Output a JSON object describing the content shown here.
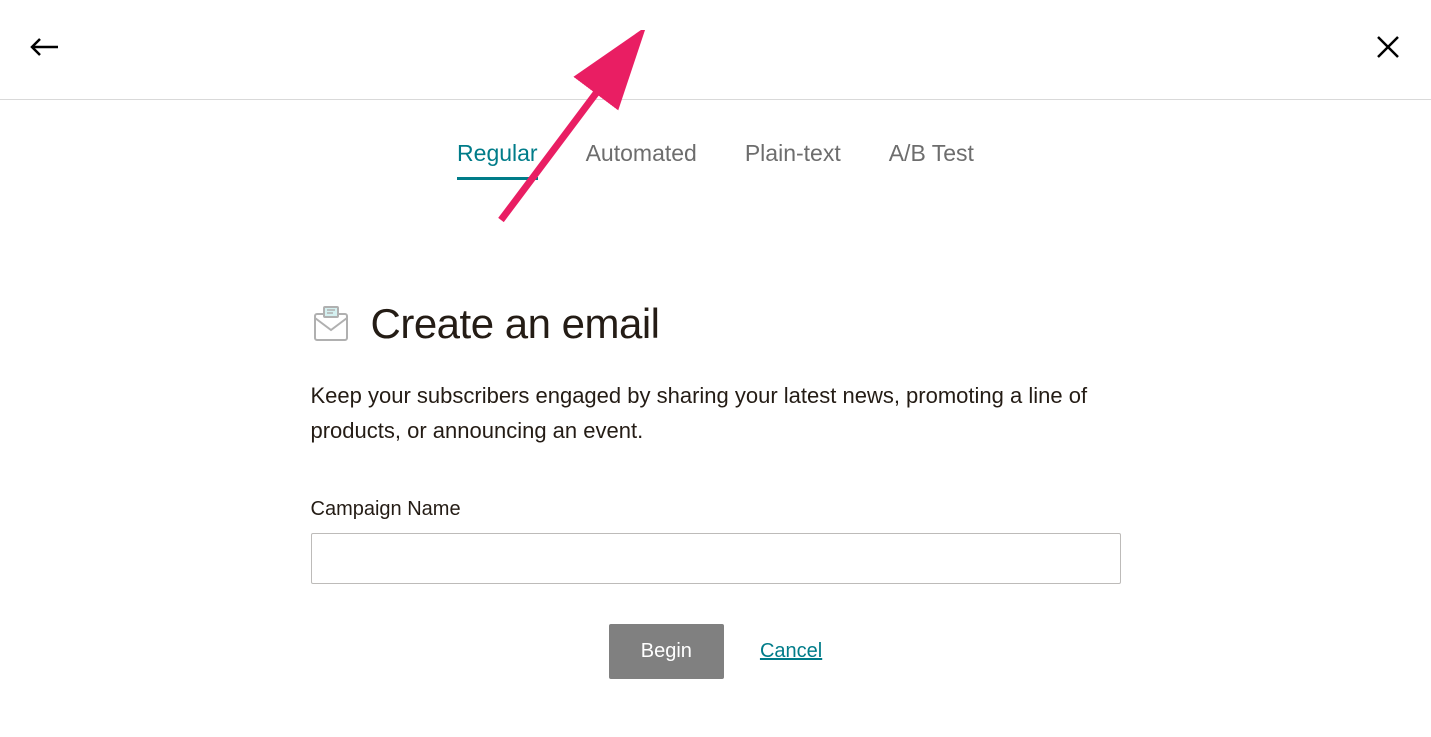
{
  "header": {
    "back_icon": "arrow-left",
    "close_icon": "close"
  },
  "tabs": [
    {
      "label": "Regular",
      "active": true
    },
    {
      "label": "Automated",
      "active": false
    },
    {
      "label": "Plain-text",
      "active": false
    },
    {
      "label": "A/B Test",
      "active": false
    }
  ],
  "main": {
    "title": "Create an email",
    "description": "Keep your subscribers engaged by sharing your latest news, promoting a line of products, or announcing an event.",
    "field_label": "Campaign Name",
    "field_value": "",
    "begin_button": "Begin",
    "cancel_link": "Cancel"
  },
  "colors": {
    "accent": "#007c89",
    "annotation": "#e91e63"
  }
}
